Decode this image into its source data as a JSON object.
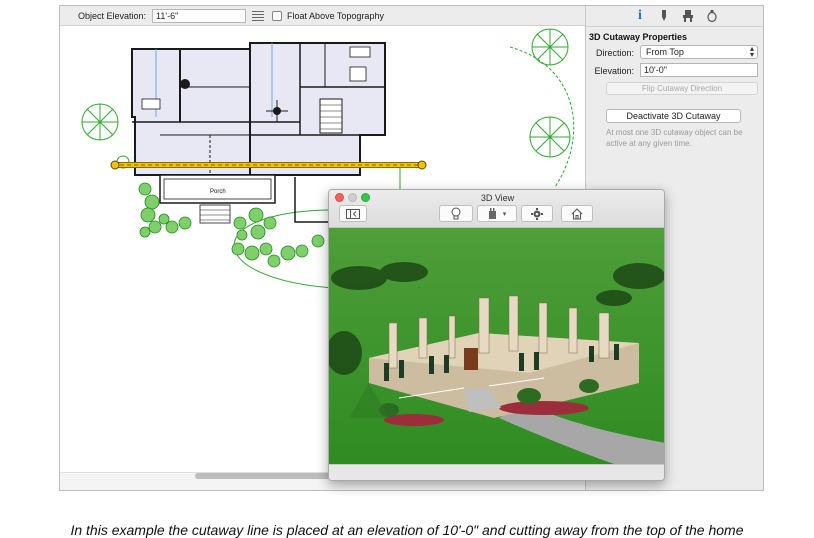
{
  "toolbar": {
    "object_elevation_label": "Object Elevation:",
    "object_elevation_value": "11'-6\"",
    "float_label": "Float Above Topography",
    "float_checked": false
  },
  "plan": {
    "porch_label": "Porch"
  },
  "inspector": {
    "tabs": [
      {
        "name": "info",
        "glyph": "i",
        "active": true
      },
      {
        "name": "pen",
        "glyph": "",
        "active": false
      },
      {
        "name": "object",
        "glyph": "",
        "active": false
      },
      {
        "name": "materials",
        "glyph": "",
        "active": false
      }
    ],
    "title": "3D Cutaway Properties",
    "direction_label": "Direction:",
    "direction_value": "From Top",
    "elevation_label": "Elevation:",
    "elevation_value": "10'-0\"",
    "flip_button": "Flip Cutaway Direction",
    "deactivate_button": "Deactivate 3D Cutaway",
    "note": "At most one 3D cutaway object can be active at any given time."
  },
  "view3d": {
    "title": "3D View",
    "toolbar_icons": [
      "sidebar-icon",
      "lightbulb-icon",
      "paint-bucket-icon",
      "gear-icon",
      "home-icon"
    ]
  },
  "colors": {
    "cutaway_line": "#f2c200",
    "cutaway_line_edge": "#8a6a00",
    "landscape_green": "#2fa82f",
    "plan_fill": "#e8e8f4",
    "grass": "#3f9a2c",
    "house_wall": "#cdbda0",
    "info_tab": "#1f6fe0"
  },
  "caption": "In this example the cutaway line is placed at an elevation of 10'-0\" and cutting away from the top of the home"
}
